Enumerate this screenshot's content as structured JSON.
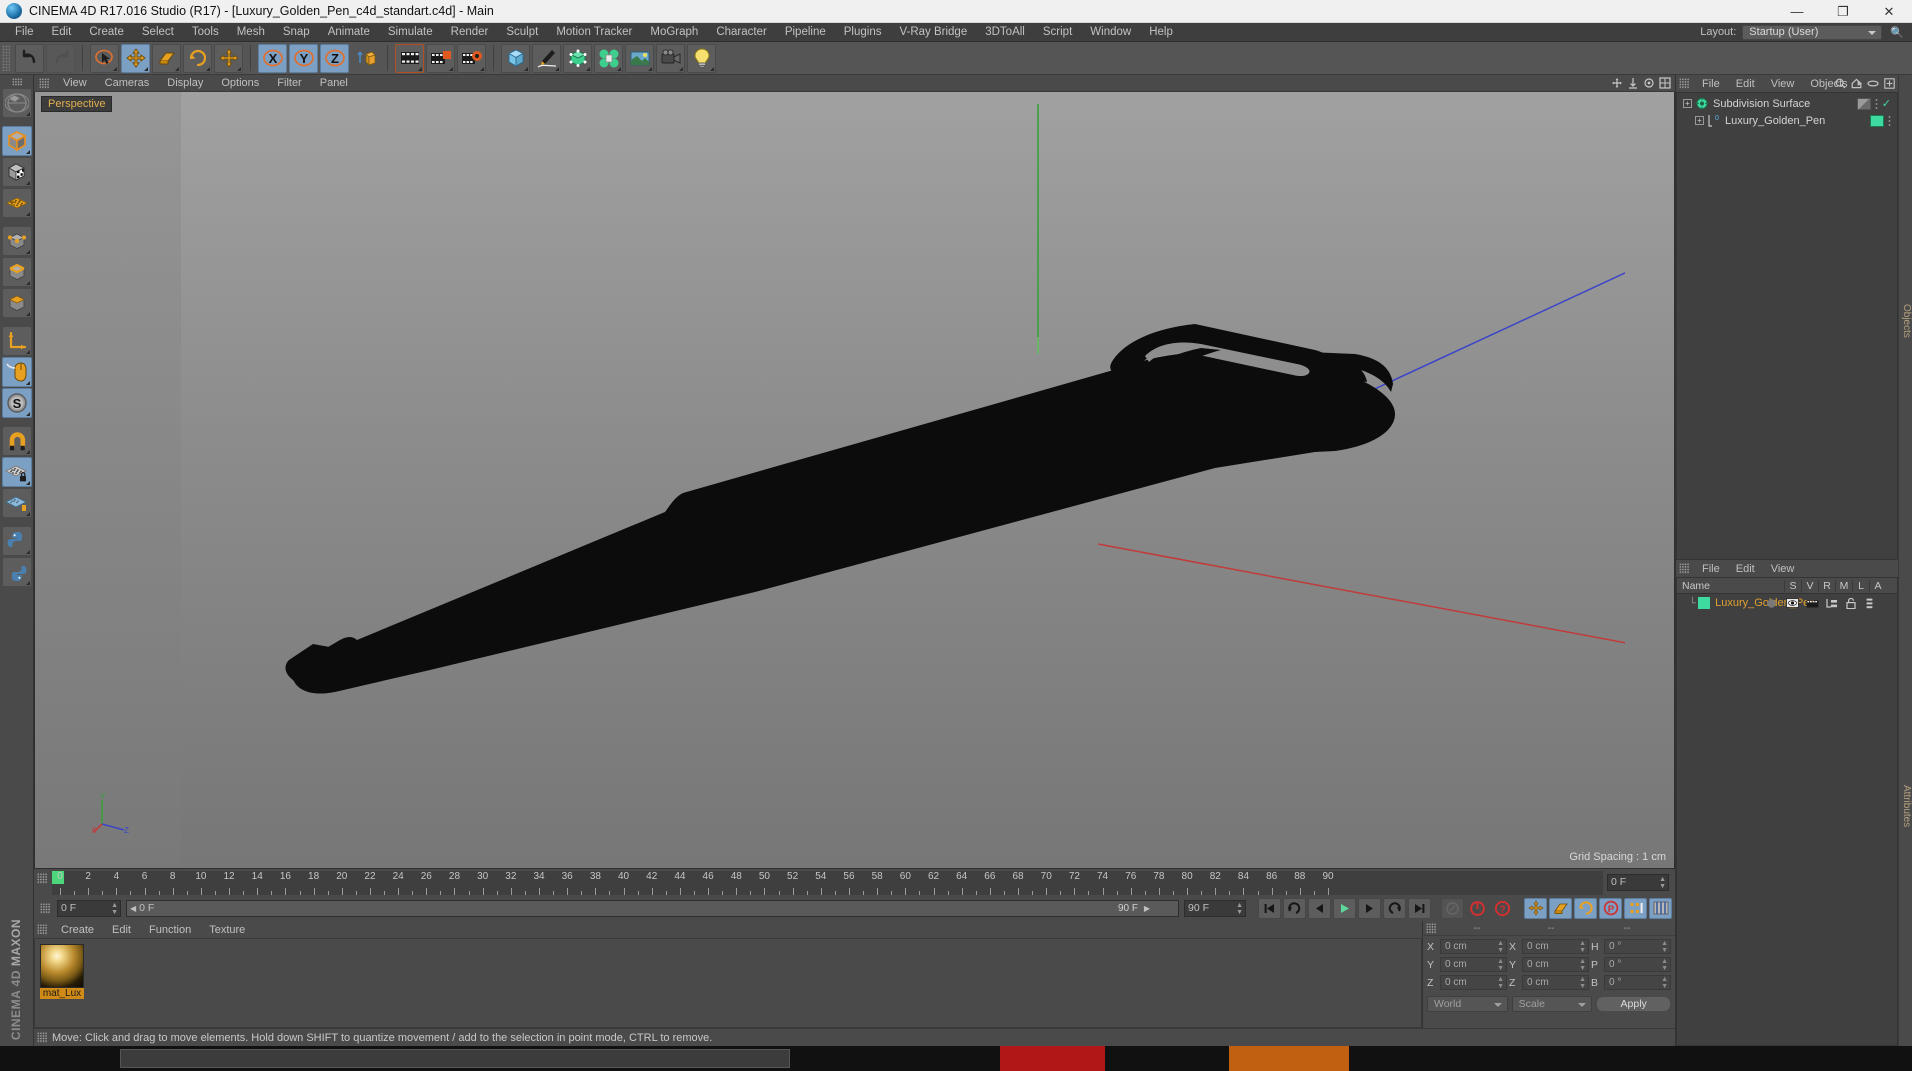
{
  "window": {
    "title": "CINEMA 4D R17.016 Studio (R17) - [Luxury_Golden_Pen_c4d_standart.c4d] - Main",
    "minimize": "—",
    "maximize": "❐",
    "close": "✕"
  },
  "menubar": {
    "items": [
      "File",
      "Edit",
      "Create",
      "Select",
      "Tools",
      "Mesh",
      "Snap",
      "Animate",
      "Simulate",
      "Render",
      "Sculpt",
      "Motion Tracker",
      "MoGraph",
      "Character",
      "Pipeline",
      "Plugins",
      "V-Ray Bridge",
      "3DToAll",
      "Script",
      "Window",
      "Help"
    ]
  },
  "layout": {
    "label": "Layout:",
    "value": "Startup (User)"
  },
  "toolbar": {
    "groups": [
      {
        "name": "undo-redo",
        "buttons": [
          {
            "name": "undo-button",
            "icon": "undo-icon",
            "active": false
          },
          {
            "name": "redo-button",
            "icon": "redo-icon",
            "active": false,
            "disabled": true
          }
        ]
      },
      {
        "name": "transform-tools",
        "buttons": [
          {
            "name": "selection-tool",
            "icon": "live-selection-icon",
            "active": false
          },
          {
            "name": "move-tool",
            "icon": "move-icon",
            "active": true
          },
          {
            "name": "scale-tool",
            "icon": "scale-icon",
            "active": false
          },
          {
            "name": "rotate-tool",
            "icon": "rotate-icon",
            "active": false
          },
          {
            "name": "move-axis-tool",
            "icon": "move-axis-icon",
            "active": false
          }
        ]
      },
      {
        "name": "axis-locks",
        "buttons": [
          {
            "name": "lock-x-axis",
            "icon": "x-axis-icon",
            "active": true
          },
          {
            "name": "lock-y-axis",
            "icon": "y-axis-icon",
            "active": true
          },
          {
            "name": "lock-z-axis",
            "icon": "z-axis-icon",
            "active": true
          },
          {
            "name": "world-object-coords",
            "icon": "world-axis-icon",
            "active": false
          }
        ]
      },
      {
        "name": "render-tools",
        "buttons": [
          {
            "name": "render-view",
            "icon": "render-view-icon",
            "active": false
          },
          {
            "name": "render-to-picture-viewer",
            "icon": "render-picture-icon",
            "active": false
          },
          {
            "name": "render-settings",
            "icon": "render-settings-icon",
            "active": false
          }
        ]
      },
      {
        "name": "create-tools",
        "buttons": [
          {
            "name": "add-cube-object",
            "icon": "cube-icon",
            "active": false
          },
          {
            "name": "add-spline",
            "icon": "pen-spline-icon",
            "active": false
          },
          {
            "name": "add-generator",
            "icon": "generator-icon",
            "active": false
          },
          {
            "name": "add-deformer",
            "icon": "deformer-icon",
            "active": false
          },
          {
            "name": "add-scene-object",
            "icon": "environment-icon",
            "active": false
          },
          {
            "name": "add-camera",
            "icon": "camera-icon",
            "active": false
          },
          {
            "name": "add-light",
            "icon": "light-bulb-icon",
            "active": false
          }
        ]
      }
    ]
  },
  "left_toolbar": {
    "buttons": [
      {
        "name": "make-editable",
        "icon": "make-editable-icon",
        "active": false
      },
      {
        "name": "model-mode",
        "icon": "model-mode-icon",
        "active": true
      },
      {
        "name": "texture-mode",
        "icon": "texture-mode-icon",
        "active": false
      },
      {
        "name": "points-grid-mode",
        "icon": "grid-points-icon",
        "active": false
      },
      {
        "name": "point-mode",
        "icon": "point-mode-icon",
        "active": false
      },
      {
        "name": "edge-mode",
        "icon": "edge-mode-icon",
        "active": false
      },
      {
        "name": "polygon-mode",
        "icon": "polygon-mode-icon",
        "active": false
      },
      {
        "name": "world-axis-mode",
        "icon": "axis-l-icon",
        "active": false
      },
      {
        "name": "viewport-solo",
        "icon": "mouse-icon",
        "active": true
      },
      {
        "name": "scale-snap",
        "icon": "s-circle-icon",
        "active": true
      },
      {
        "name": "enable-snap",
        "icon": "magnet-icon",
        "active": false
      },
      {
        "name": "workplane-lock",
        "icon": "workplane-lock-icon",
        "active": true
      },
      {
        "name": "quantize-snap",
        "icon": "quantize-icon",
        "active": false
      },
      {
        "name": "python-tool",
        "icon": "python-icon",
        "active": false
      },
      {
        "name": "python-tag",
        "icon": "python-tag-icon",
        "active": false
      }
    ],
    "brand_top": "CINEMA 4D",
    "brand_bottom": "MAXON"
  },
  "viewport": {
    "menu": [
      "View",
      "Cameras",
      "Display",
      "Options",
      "Filter",
      "Panel"
    ],
    "label": "Perspective",
    "grid_spacing": "Grid Spacing : 1 cm",
    "axis_gizmo": {
      "y": "Y",
      "x": "X",
      "z": "Z"
    }
  },
  "timeline": {
    "ticks": [
      0,
      2,
      4,
      6,
      8,
      10,
      12,
      14,
      16,
      18,
      20,
      22,
      24,
      26,
      28,
      30,
      32,
      34,
      36,
      38,
      40,
      42,
      44,
      46,
      48,
      50,
      52,
      54,
      56,
      58,
      60,
      62,
      64,
      66,
      68,
      70,
      72,
      74,
      76,
      78,
      80,
      82,
      84,
      86,
      88,
      90
    ],
    "current_frame": "0 F",
    "range_start_field": "0 F",
    "range_preview": "0 F",
    "range_end_field": "90 F",
    "range_max_field": "90 F",
    "playhead_frame": 0
  },
  "transport": {
    "buttons": [
      {
        "name": "go-to-start-button",
        "icon": "skip-start-icon"
      },
      {
        "name": "previous-key-button",
        "icon": "prev-key-icon"
      },
      {
        "name": "step-back-button",
        "icon": "step-back-icon"
      },
      {
        "name": "play-button",
        "icon": "play-icon"
      },
      {
        "name": "step-forward-button",
        "icon": "step-forward-icon"
      },
      {
        "name": "next-key-button",
        "icon": "next-key-icon"
      },
      {
        "name": "go-to-end-button",
        "icon": "skip-end-icon"
      },
      {
        "name": "record-active-objects-button",
        "icon": "record-icon"
      },
      {
        "name": "autokeying-button",
        "icon": "autokey-icon"
      },
      {
        "name": "keyframe-selection-button",
        "icon": "key-select-icon"
      },
      {
        "name": "position-key-button",
        "icon": "position-key-icon"
      },
      {
        "name": "scale-key-button",
        "icon": "scale-key-icon"
      },
      {
        "name": "rotation-key-button",
        "icon": "rotation-key-icon"
      },
      {
        "name": "parameter-key-button",
        "icon": "param-key-icon"
      },
      {
        "name": "point-level-animation-button",
        "icon": "pla-icon"
      },
      {
        "name": "timeline-button",
        "icon": "timeline-icon"
      }
    ]
  },
  "material_manager": {
    "menu": [
      "Create",
      "Edit",
      "Function",
      "Texture"
    ],
    "materials": [
      {
        "name": "mat_Lux",
        "label": "mat_Lux"
      }
    ]
  },
  "attributes": {
    "header_cells": [
      "--",
      "--",
      "--"
    ],
    "position": {
      "x_label": "X",
      "x": "0 cm",
      "y_label": "Y",
      "y": "0 cm",
      "z_label": "Z",
      "z": "0 cm"
    },
    "size": {
      "x_label": "X",
      "x": "0 cm",
      "y_label": "Y",
      "y": "0 cm",
      "z_label": "Z",
      "z": "0 cm"
    },
    "rotation": {
      "h_label": "H",
      "h": "0 °",
      "p_label": "P",
      "p": "0 °",
      "b_label": "B",
      "b": "0 °"
    },
    "coord_system": "World",
    "coord_mode": "Scale",
    "apply": "Apply"
  },
  "object_manager": {
    "menu": [
      "File",
      "Edit",
      "View",
      "Objects"
    ],
    "tab_label": "Objects",
    "items": [
      {
        "name": "Subdivision Surface",
        "indent": 0,
        "tag_color": "#3ddba0",
        "has_check": true
      },
      {
        "name": "Luxury_Golden_Pen",
        "indent": 1,
        "tag_color": "#3ddba0",
        "has_check": false
      }
    ]
  },
  "layer_manager": {
    "menu": [
      "File",
      "Edit",
      "View"
    ],
    "tab_label": "Attributes",
    "columns": [
      "Name",
      "S",
      "V",
      "R",
      "M",
      "L",
      "A"
    ],
    "rows": [
      {
        "name": "Luxury_Golden_Pen",
        "color": "#3ddba0"
      }
    ]
  },
  "statusbar": {
    "text": "Move: Click and drag to move elements. Hold down SHIFT to quantize movement / add to the selection in point mode, CTRL to remove."
  },
  "colors": {
    "accent_orange": "#e0a030",
    "green_tag": "#3ddba0",
    "axis_x": "#d04040",
    "axis_y": "#50c050",
    "axis_z": "#4050d0",
    "selection_blue": "#7c9fc4"
  }
}
